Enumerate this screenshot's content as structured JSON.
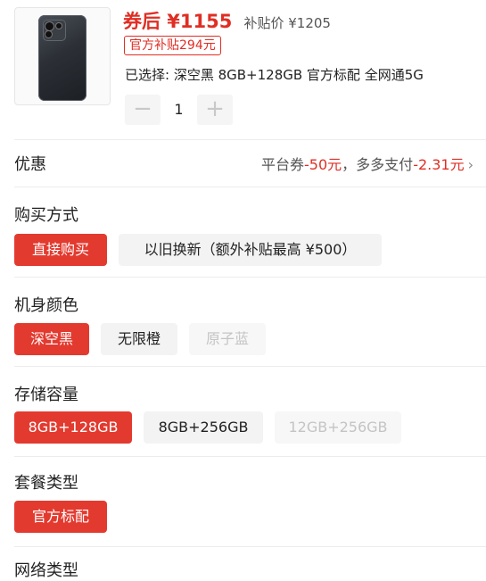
{
  "product": {
    "image_icon": "phone-product-image",
    "price_main": "券后 ¥1155",
    "price_subsidy": "补贴价 ¥1205",
    "subsidy_badge": "官方补贴294元",
    "selected_summary": "已选择: 深空黑 8GB+128GB 官方标配 全网通5G",
    "quantity": "1",
    "qty_minus": "−",
    "qty_plus": "+"
  },
  "discount": {
    "title": "优惠",
    "platform_label": "平台券",
    "platform_value": "-50元",
    "separator": "，",
    "pay_label": "多多支付",
    "pay_value": "-2.31元",
    "chevron": "›"
  },
  "purchase_method": {
    "title": "购买方式",
    "options": [
      {
        "label": "直接购买",
        "state": "selected"
      },
      {
        "label": "以旧换新（额外补贴最高 ¥500）",
        "state": "normal"
      }
    ]
  },
  "color": {
    "title": "机身颜色",
    "options": [
      {
        "label": "深空黑",
        "state": "selected"
      },
      {
        "label": "无限橙",
        "state": "normal"
      },
      {
        "label": "原子蓝",
        "state": "disabled"
      }
    ]
  },
  "storage": {
    "title": "存储容量",
    "options": [
      {
        "label": "8GB+128GB",
        "state": "selected"
      },
      {
        "label": "8GB+256GB",
        "state": "normal"
      },
      {
        "label": "12GB+256GB",
        "state": "disabled"
      }
    ]
  },
  "package": {
    "title": "套餐类型",
    "options": [
      {
        "label": "官方标配",
        "state": "selected"
      }
    ]
  },
  "network": {
    "title": "网络类型"
  },
  "colors": {
    "accent": "#e02e24",
    "selected_bg": "#e33a2f",
    "option_bg": "#f3f3f3",
    "disabled_text": "#c4c4c4"
  }
}
